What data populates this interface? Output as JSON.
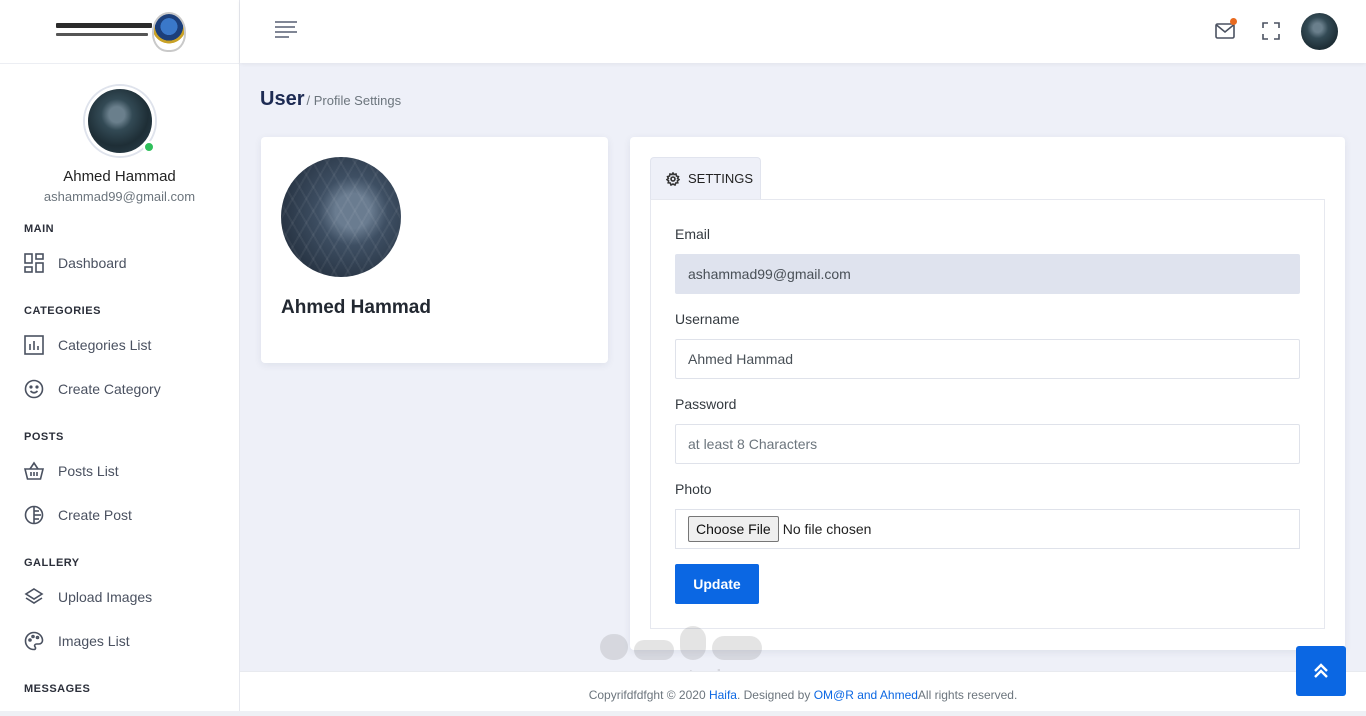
{
  "sidebar": {
    "profile": {
      "name": "Ahmed Hammad",
      "email": "ashammad99@gmail.com"
    },
    "sections": {
      "main": {
        "heading": "MAIN",
        "items": [
          {
            "label": "Dashboard",
            "icon": "dashboard-icon"
          }
        ]
      },
      "categories": {
        "heading": "CATEGORIES",
        "items": [
          {
            "label": "Categories List",
            "icon": "bar-chart-icon"
          },
          {
            "label": "Create Category",
            "icon": "smiley-icon"
          }
        ]
      },
      "posts": {
        "heading": "POSTS",
        "items": [
          {
            "label": "Posts List",
            "icon": "basket-icon"
          },
          {
            "label": "Create Post",
            "icon": "half-circle-icon"
          }
        ]
      },
      "gallery": {
        "heading": "GALLERY",
        "items": [
          {
            "label": "Upload Images",
            "icon": "layers-icon"
          },
          {
            "label": "Images List",
            "icon": "palette-icon"
          }
        ]
      },
      "messages": {
        "heading": "MESSAGES"
      }
    }
  },
  "topbar": {
    "icons": [
      "menu-icon",
      "mail-icon",
      "fullscreen-icon",
      "user-avatar"
    ],
    "notification_color": "#e86a1f"
  },
  "header": {
    "title": "User",
    "breadcrumb": "/ Profile Settings"
  },
  "profile_card": {
    "name": "Ahmed Hammad"
  },
  "settings": {
    "tab_label": "SETTINGS",
    "email_label": "Email",
    "email_value": "ashammad99@gmail.com",
    "username_label": "Username",
    "username_value": "Ahmed Hammad",
    "password_label": "Password",
    "password_placeholder": "at least 8 Characters",
    "photo_label": "Photo",
    "choose_file_label": "Choose File",
    "no_file_text": "No file chosen",
    "update_label": "Update"
  },
  "footer": {
    "prefix": "Copyrifdfdfght © 2020 ",
    "brand": "Haifa",
    "middle": ". Designed by ",
    "authors": "OM@R and Ahmed",
    "suffix": "All rights reserved."
  },
  "watermark": {
    "text": "mostaql.com"
  },
  "colors": {
    "primary": "#0b67e3",
    "title": "#1d2b53",
    "online": "#2fbf5b",
    "background": "#eef0f8"
  }
}
